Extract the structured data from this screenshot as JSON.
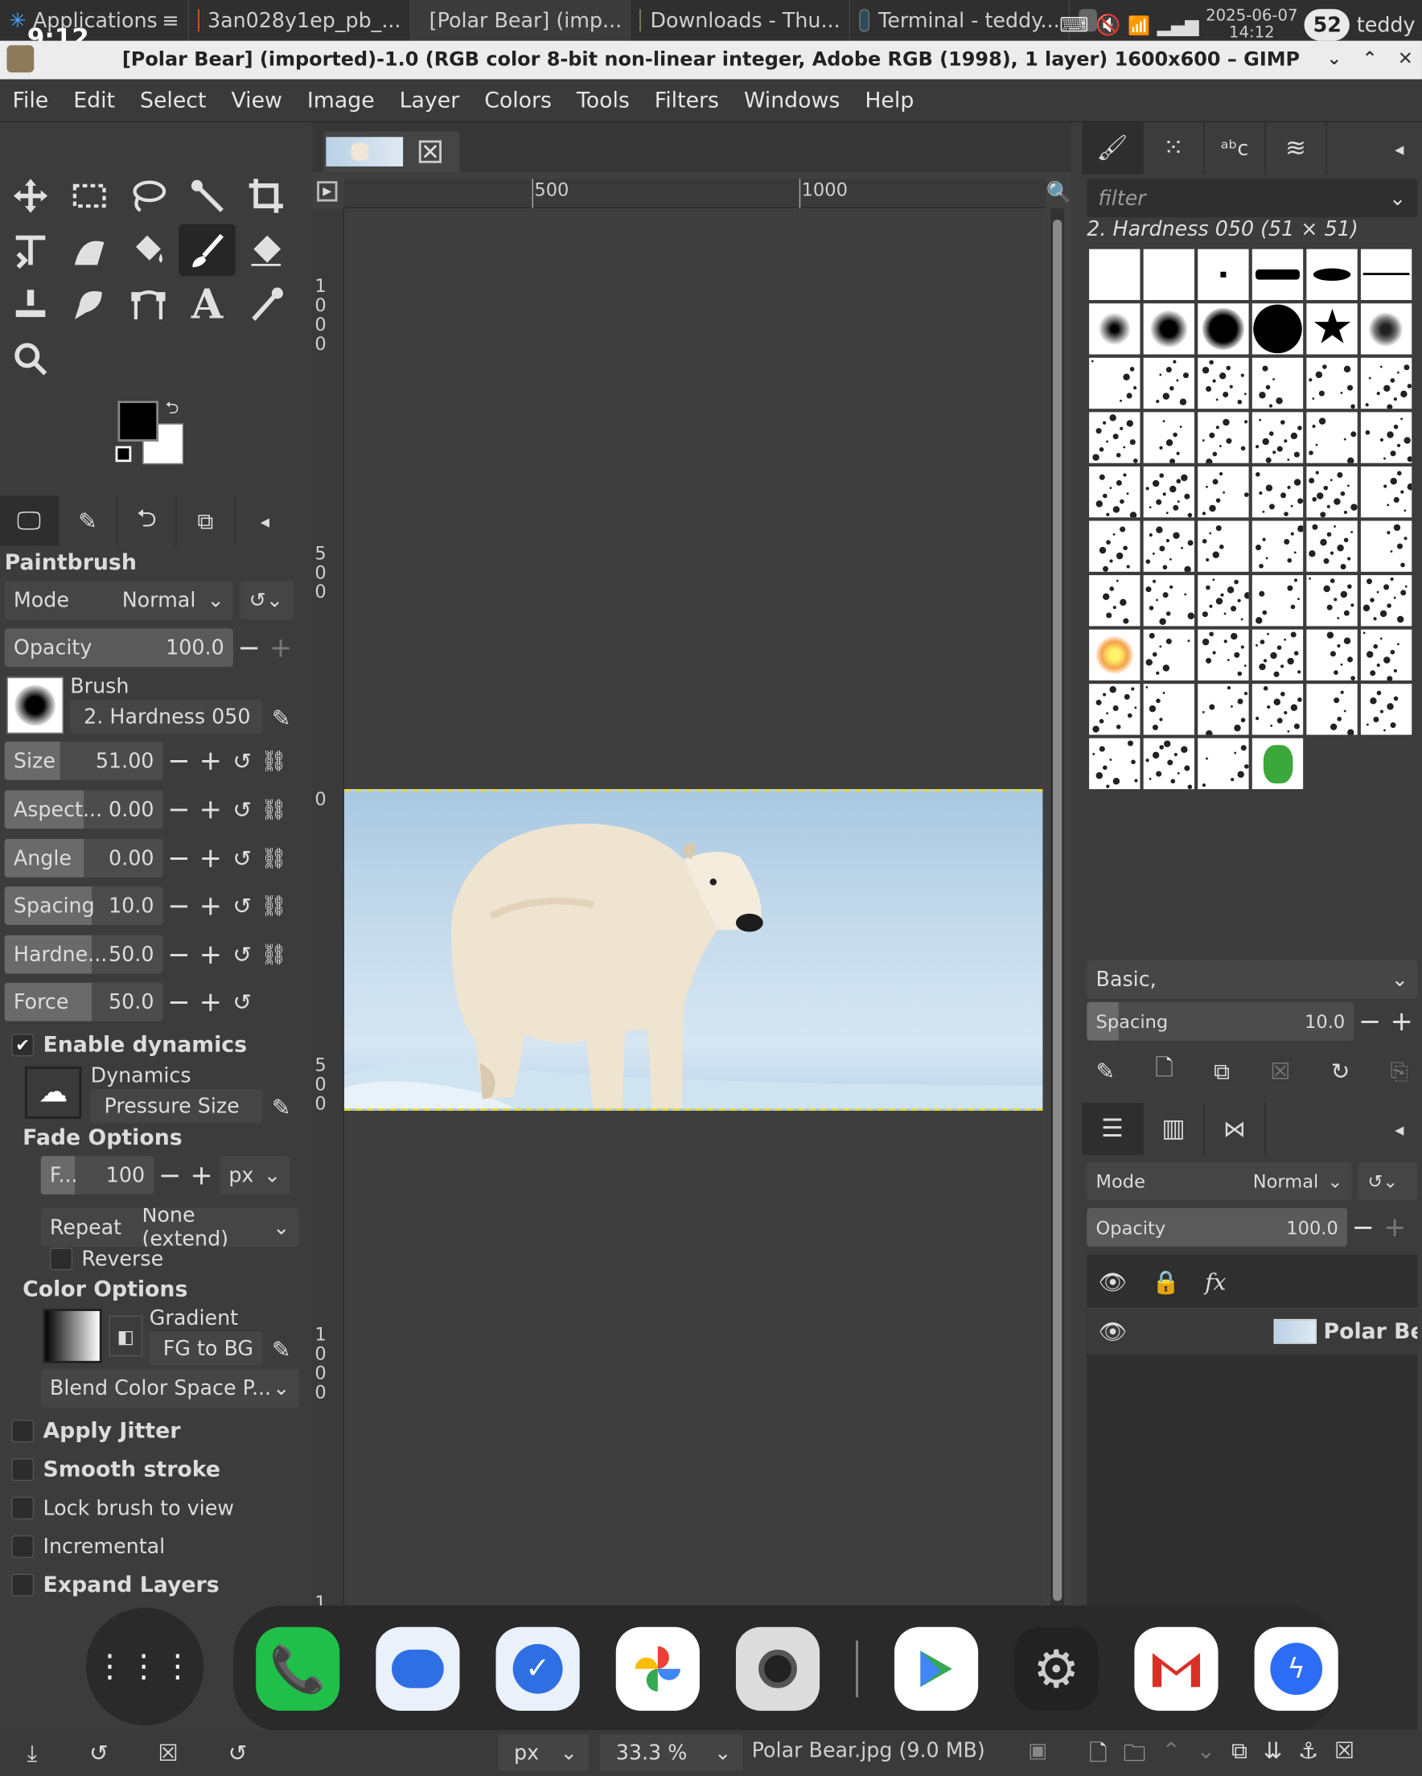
{
  "system": {
    "apps_label": "Applications",
    "tasks": [
      {
        "label": "3an028y1ep_pb_...",
        "color": "#e8692a"
      },
      {
        "label": "[Polar Bear] (imp...",
        "color": "#888888"
      },
      {
        "label": "Downloads - Thu...",
        "color": "#9b8f6a"
      },
      {
        "label": "Terminal - teddy...",
        "color": "#2f4a5a"
      }
    ],
    "date": "2025-06-07",
    "time": "14:12",
    "user": "teddy",
    "clock_overlay": "9:12",
    "battery": "52"
  },
  "window": {
    "title": "[Polar Bear] (imported)-1.0 (RGB color 8-bit non-linear integer, Adobe RGB (1998), 1 layer) 1600x600 – GIMP"
  },
  "menu": [
    "File",
    "Edit",
    "Select",
    "View",
    "Image",
    "Layer",
    "Colors",
    "Tools",
    "Filters",
    "Windows",
    "Help"
  ],
  "tool_options": {
    "title": "Paintbrush",
    "mode_label": "Mode",
    "mode_value": "Normal",
    "opacity_label": "Opacity",
    "opacity_value": "100.0",
    "brush_label": "Brush",
    "brush_value": "2. Hardness 050",
    "size_label": "Size",
    "size_value": "51.00",
    "aspect_label": "Aspect...",
    "aspect_value": "0.00",
    "angle_label": "Angle",
    "angle_value": "0.00",
    "spacing_label": "Spacing",
    "spacing_value": "10.0",
    "hardness_label": "Hardne...",
    "hardness_value": "50.0",
    "force_label": "Force",
    "force_value": "50.0",
    "enable_dynamics": "Enable dynamics",
    "dynamics_label": "Dynamics",
    "dynamics_value": "Pressure Size",
    "fade_options": "Fade Options",
    "fade_label": "F...",
    "fade_value": "100",
    "fade_unit": "px",
    "repeat_label": "Repeat",
    "repeat_value": "None (extend)",
    "reverse": "Reverse",
    "color_options": "Color Options",
    "gradient_label": "Gradient",
    "gradient_value": "FG to BG",
    "blend_value": "Blend Color Space P...",
    "apply_jitter": "Apply Jitter",
    "smooth_stroke": "Smooth stroke",
    "lock_brush": "Lock brush to view",
    "incremental": "Incremental",
    "expand_layers": "Expand Layers"
  },
  "rulers": {
    "top": [
      "500",
      "1000"
    ],
    "left": [
      "1000",
      "500",
      "0",
      "500",
      "1000",
      "1"
    ]
  },
  "brushes": {
    "filter_placeholder": "filter",
    "current": "2. Hardness 050 (51 × 51)",
    "tag": "Basic,",
    "spacing_label": "Spacing",
    "spacing_value": "10.0"
  },
  "layers": {
    "mode_label": "Mode",
    "mode_value": "Normal",
    "opacity_label": "Opacity",
    "opacity_value": "100.0",
    "fx_label": "fx",
    "layer_name": "Polar Bear"
  },
  "statusbar": {
    "unit": "px",
    "zoom": "33.3 %",
    "file": "Polar Bear.jpg (9.0 MB)"
  },
  "colors": {
    "accent_selection": "#e6d93a",
    "phone": "#1fbf4a",
    "messages": "#2f6fe4",
    "gmail_red": "#d93025",
    "messenger": "#2d6df6"
  }
}
